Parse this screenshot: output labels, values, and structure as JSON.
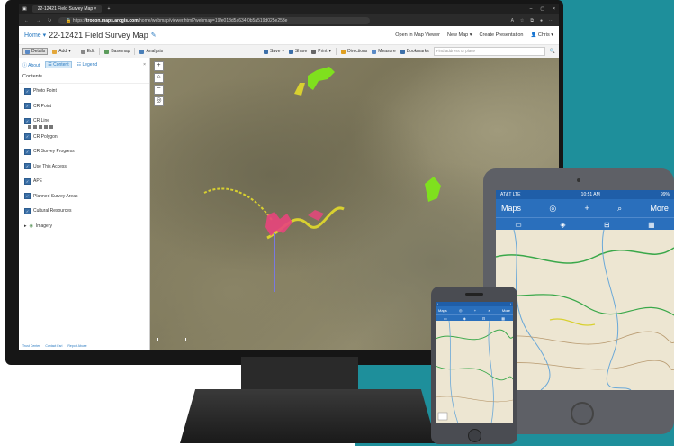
{
  "browser": {
    "tab_title": "22-12421 Field Survey Map",
    "new_tab": "+",
    "url_host": "trocon.maps.arcgis.com",
    "url_path": "/home/webmap/viewer.html?webmap=19fe018d5a634f0b5a519d025e253e",
    "https": "https://",
    "win_min": "–",
    "win_max": "▢",
    "win_close": "×"
  },
  "app": {
    "home": "Home",
    "map_title": "22-12421 Field Survey Map",
    "edit_icon": "✎",
    "open_viewer": "Open in Map Viewer",
    "new_map": "New Map",
    "create_presentation": "Create Presentation",
    "user": "Chris"
  },
  "toolbar": {
    "details": "Details",
    "add": "Add",
    "edit": "Edit",
    "basemap": "Basemap",
    "analysis": "Analysis",
    "save": "Save",
    "share": "Share",
    "print": "Print",
    "directions": "Directions",
    "measure": "Measure",
    "bookmarks": "Bookmarks",
    "find_placeholder": "Find address or place"
  },
  "panel": {
    "tab_about": "About",
    "tab_content": "Content",
    "tab_legend": "Legend",
    "close": "×",
    "heading": "Contents",
    "layers": [
      "Photo Point",
      "CR Point",
      "CR Line",
      "CR Polygon",
      "CR Survey Progress",
      "Use This Access",
      "APE",
      "Planned Survey Areas",
      "Cultural Resources",
      "Imagery"
    ],
    "footer": [
      "Trust Center",
      "Contact Esri",
      "Report Abuse"
    ]
  },
  "map": {
    "zoom_in": "+",
    "zoom_out": "−",
    "home": "⌂"
  },
  "tablet": {
    "carrier": "AT&T LTE",
    "time": "10:51 AM",
    "battery": "99%",
    "maps": "Maps",
    "more": "More"
  },
  "phone": {
    "maps": "Maps",
    "more": "More"
  },
  "colors": {
    "teal": "#1e8f9b",
    "accent_blue": "#2a7ac1",
    "mobile_nav": "#2a6fbc",
    "survey_pink": "#e8457c",
    "survey_yellow": "#d8d030",
    "survey_green": "#7fe01e"
  }
}
